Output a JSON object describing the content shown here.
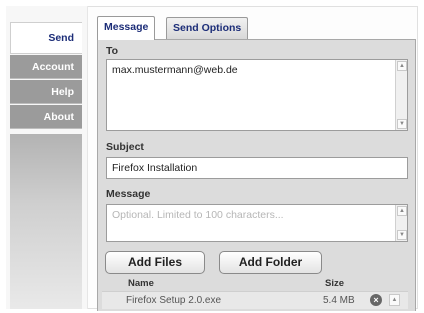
{
  "sidebar": {
    "items": [
      {
        "label": "Send",
        "active": true
      },
      {
        "label": "Account",
        "active": false
      },
      {
        "label": "Help",
        "active": false
      },
      {
        "label": "About",
        "active": false
      }
    ]
  },
  "tabs": [
    {
      "label": "Message",
      "active": true
    },
    {
      "label": "Send Options",
      "active": false
    }
  ],
  "form": {
    "to_label": "To",
    "to_value": "max.mustermann@web.de",
    "subject_label": "Subject",
    "subject_value": "Firefox Installation",
    "message_label": "Message",
    "message_placeholder": "Optional. Limited to 100 characters..."
  },
  "buttons": {
    "add_files": "Add Files",
    "add_folder": "Add Folder"
  },
  "files": {
    "columns": {
      "name": "Name",
      "size": "Size"
    },
    "rows": [
      {
        "name": "Firefox Setup 2.0.exe",
        "size": "5.4 MB"
      }
    ]
  },
  "icons": {
    "remove": "remove-circle-icon",
    "scroll_up": "arrow-up-icon",
    "scroll_down": "arrow-down-icon"
  },
  "colors": {
    "accent_text": "#1c2d78",
    "nav_inactive": "#9b9b9b",
    "panel_bg": "#dcdcdc"
  }
}
